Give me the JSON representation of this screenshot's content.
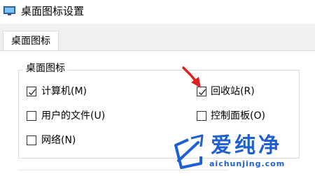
{
  "window": {
    "title": "桌面图标设置",
    "icon": "desktop-settings-icon"
  },
  "tabs": [
    {
      "label": "桌面图标",
      "selected": true
    }
  ],
  "group": {
    "legend": "桌面图标",
    "checkboxes": [
      {
        "label": "计算机(M)",
        "checked": true
      },
      {
        "label": "回收站(R)",
        "checked": true
      },
      {
        "label": "用户的文件(U)",
        "checked": false
      },
      {
        "label": "控制面板(O)",
        "checked": false
      },
      {
        "label": "网络(N)",
        "checked": false
      }
    ]
  },
  "annotation": {
    "arrow_color": "#e02020"
  },
  "watermark": {
    "text": "爱纯净",
    "url": "aichunjing.com",
    "color": "#1f5fd1"
  }
}
